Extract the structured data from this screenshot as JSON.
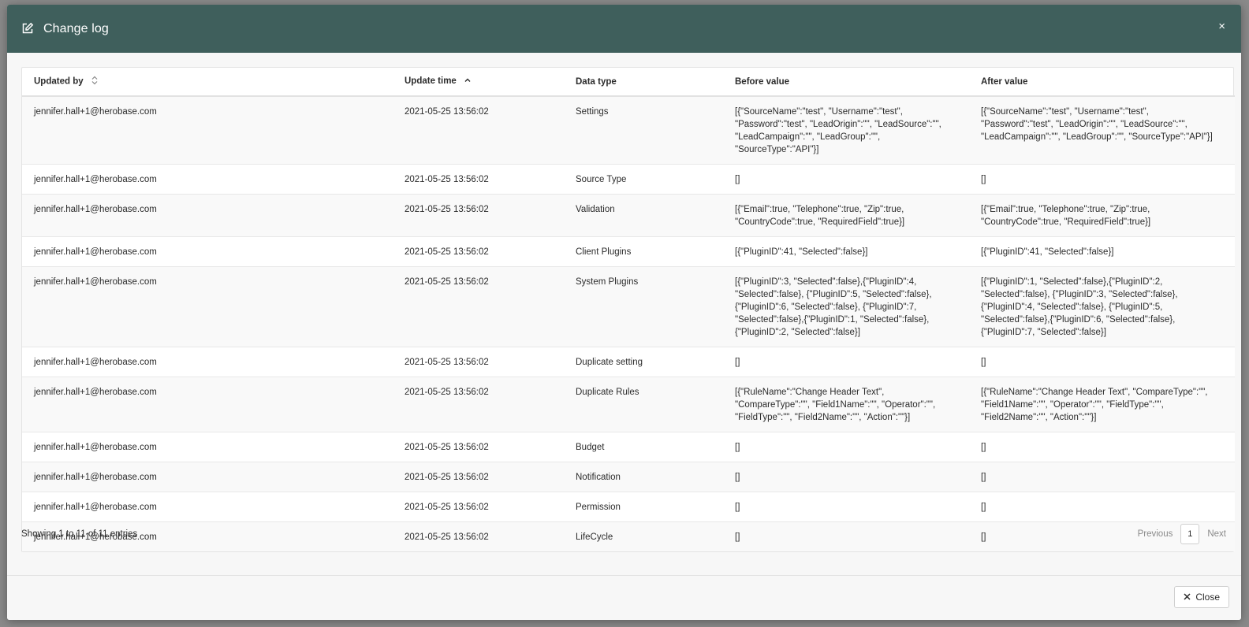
{
  "modal": {
    "title": "Change log",
    "title_icon": "edit-icon",
    "close_x": "×",
    "close_label": "Close"
  },
  "table": {
    "headers": {
      "updated_by": "Updated by",
      "update_time": "Update time",
      "data_type": "Data type",
      "before_value": "Before value",
      "after_value": "After value"
    },
    "rows": [
      {
        "updated_by": "jennifer.hall+1@herobase.com",
        "update_time": "2021-05-25 13:56:02",
        "data_type": "Settings",
        "before": "[{\"SourceName\":\"test\", \"Username\":\"test\", \"Password\":\"test\", \"LeadOrigin\":\"\", \"LeadSource\":\"\", \"LeadCampaign\":\"\", \"LeadGroup\":\"\", \"SourceType\":\"API\"}]",
        "after": "[{\"SourceName\":\"test\", \"Username\":\"test\", \"Password\":\"test\", \"LeadOrigin\":\"\", \"LeadSource\":\"\", \"LeadCampaign\":\"\", \"LeadGroup\":\"\", \"SourceType\":\"API\"}]"
      },
      {
        "updated_by": "jennifer.hall+1@herobase.com",
        "update_time": "2021-05-25 13:56:02",
        "data_type": "Source Type",
        "before": "[]",
        "after": "[]"
      },
      {
        "updated_by": "jennifer.hall+1@herobase.com",
        "update_time": "2021-05-25 13:56:02",
        "data_type": "Validation",
        "before": "[{\"Email\":true, \"Telephone\":true, \"Zip\":true, \"CountryCode\":true, \"RequiredField\":true}]",
        "after": "[{\"Email\":true, \"Telephone\":true, \"Zip\":true, \"CountryCode\":true, \"RequiredField\":true}]"
      },
      {
        "updated_by": "jennifer.hall+1@herobase.com",
        "update_time": "2021-05-25 13:56:02",
        "data_type": "Client Plugins",
        "before": "[{\"PluginID\":41, \"Selected\":false}]",
        "after": "[{\"PluginID\":41, \"Selected\":false}]"
      },
      {
        "updated_by": "jennifer.hall+1@herobase.com",
        "update_time": "2021-05-25 13:56:02",
        "data_type": "System Plugins",
        "before": "[{\"PluginID\":3, \"Selected\":false},{\"PluginID\":4, \"Selected\":false}, {\"PluginID\":5, \"Selected\":false},{\"PluginID\":6, \"Selected\":false}, {\"PluginID\":7, \"Selected\":false},{\"PluginID\":1, \"Selected\":false}, {\"PluginID\":2, \"Selected\":false}]",
        "after": "[{\"PluginID\":1, \"Selected\":false},{\"PluginID\":2, \"Selected\":false}, {\"PluginID\":3, \"Selected\":false},{\"PluginID\":4, \"Selected\":false}, {\"PluginID\":5, \"Selected\":false},{\"PluginID\":6, \"Selected\":false}, {\"PluginID\":7, \"Selected\":false}]"
      },
      {
        "updated_by": "jennifer.hall+1@herobase.com",
        "update_time": "2021-05-25 13:56:02",
        "data_type": "Duplicate setting",
        "before": "[]",
        "after": "[]"
      },
      {
        "updated_by": "jennifer.hall+1@herobase.com",
        "update_time": "2021-05-25 13:56:02",
        "data_type": "Duplicate Rules",
        "before": "[{\"RuleName\":\"Change Header Text\", \"CompareType\":\"\", \"Field1Name\":\"\", \"Operator\":\"\", \"FieldType\":\"\", \"Field2Name\":\"\", \"Action\":\"\"}]",
        "after": "[{\"RuleName\":\"Change Header Text\", \"CompareType\":\"\", \"Field1Name\":\"\", \"Operator\":\"\", \"FieldType\":\"\", \"Field2Name\":\"\", \"Action\":\"\"}]"
      },
      {
        "updated_by": "jennifer.hall+1@herobase.com",
        "update_time": "2021-05-25 13:56:02",
        "data_type": "Budget",
        "before": "[]",
        "after": "[]"
      },
      {
        "updated_by": "jennifer.hall+1@herobase.com",
        "update_time": "2021-05-25 13:56:02",
        "data_type": "Notification",
        "before": "[]",
        "after": "[]"
      },
      {
        "updated_by": "jennifer.hall+1@herobase.com",
        "update_time": "2021-05-25 13:56:02",
        "data_type": "Permission",
        "before": "[]",
        "after": "[]"
      },
      {
        "updated_by": "jennifer.hall+1@herobase.com",
        "update_time": "2021-05-25 13:56:02",
        "data_type": "LifeCycle",
        "before": "[]",
        "after": "[]"
      }
    ]
  },
  "footer": {
    "showing": "Showing 1 to 11 of 11 entries",
    "previous": "Previous",
    "page": "1",
    "next": "Next"
  },
  "colors": {
    "header_bg": "#3f5f5c",
    "row_alt": "#f9f9f9"
  }
}
